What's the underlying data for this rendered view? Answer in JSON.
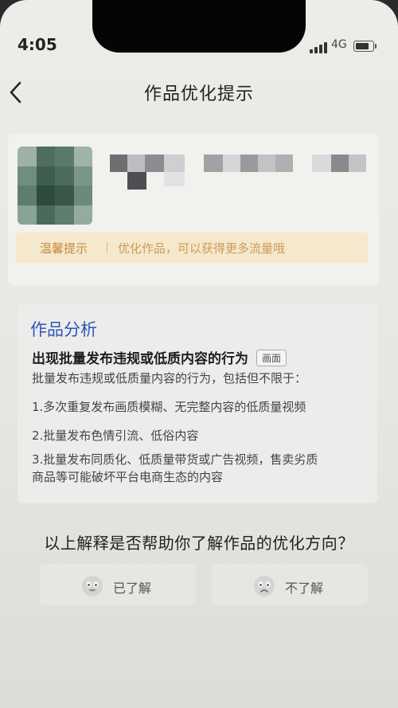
{
  "status_bar": {
    "time": "4:05",
    "network": "4G",
    "battery_level": 0.8
  },
  "nav": {
    "title": "作品优化提示",
    "back_icon": "chevron-left-icon"
  },
  "tip": {
    "label": "温馨提示",
    "text": "优化作品，可以获得更多流量哦"
  },
  "analysis": {
    "section_title": "作品分析",
    "issue_title": "出现批量发布违规或低质内容的行为",
    "issue_tag": "画面",
    "intro": "批量发布违规或低质量内容的行为，包括但不限于：",
    "items": [
      "1.多次重复发布画质模糊、无完整内容的低质量视频",
      "2.批量发布色情引流、低俗内容",
      "3.批量发布同质化、低质量带货或广告视频，售卖劣质",
      "商品等可能破坏平台电商生态的内容"
    ]
  },
  "feedback": {
    "question": "以上解释是否帮助你了解作品的优化方向？",
    "yes_label": "已了解",
    "no_label": "不了解",
    "yes_icon": "happy-face-icon",
    "no_icon": "sad-face-icon"
  }
}
